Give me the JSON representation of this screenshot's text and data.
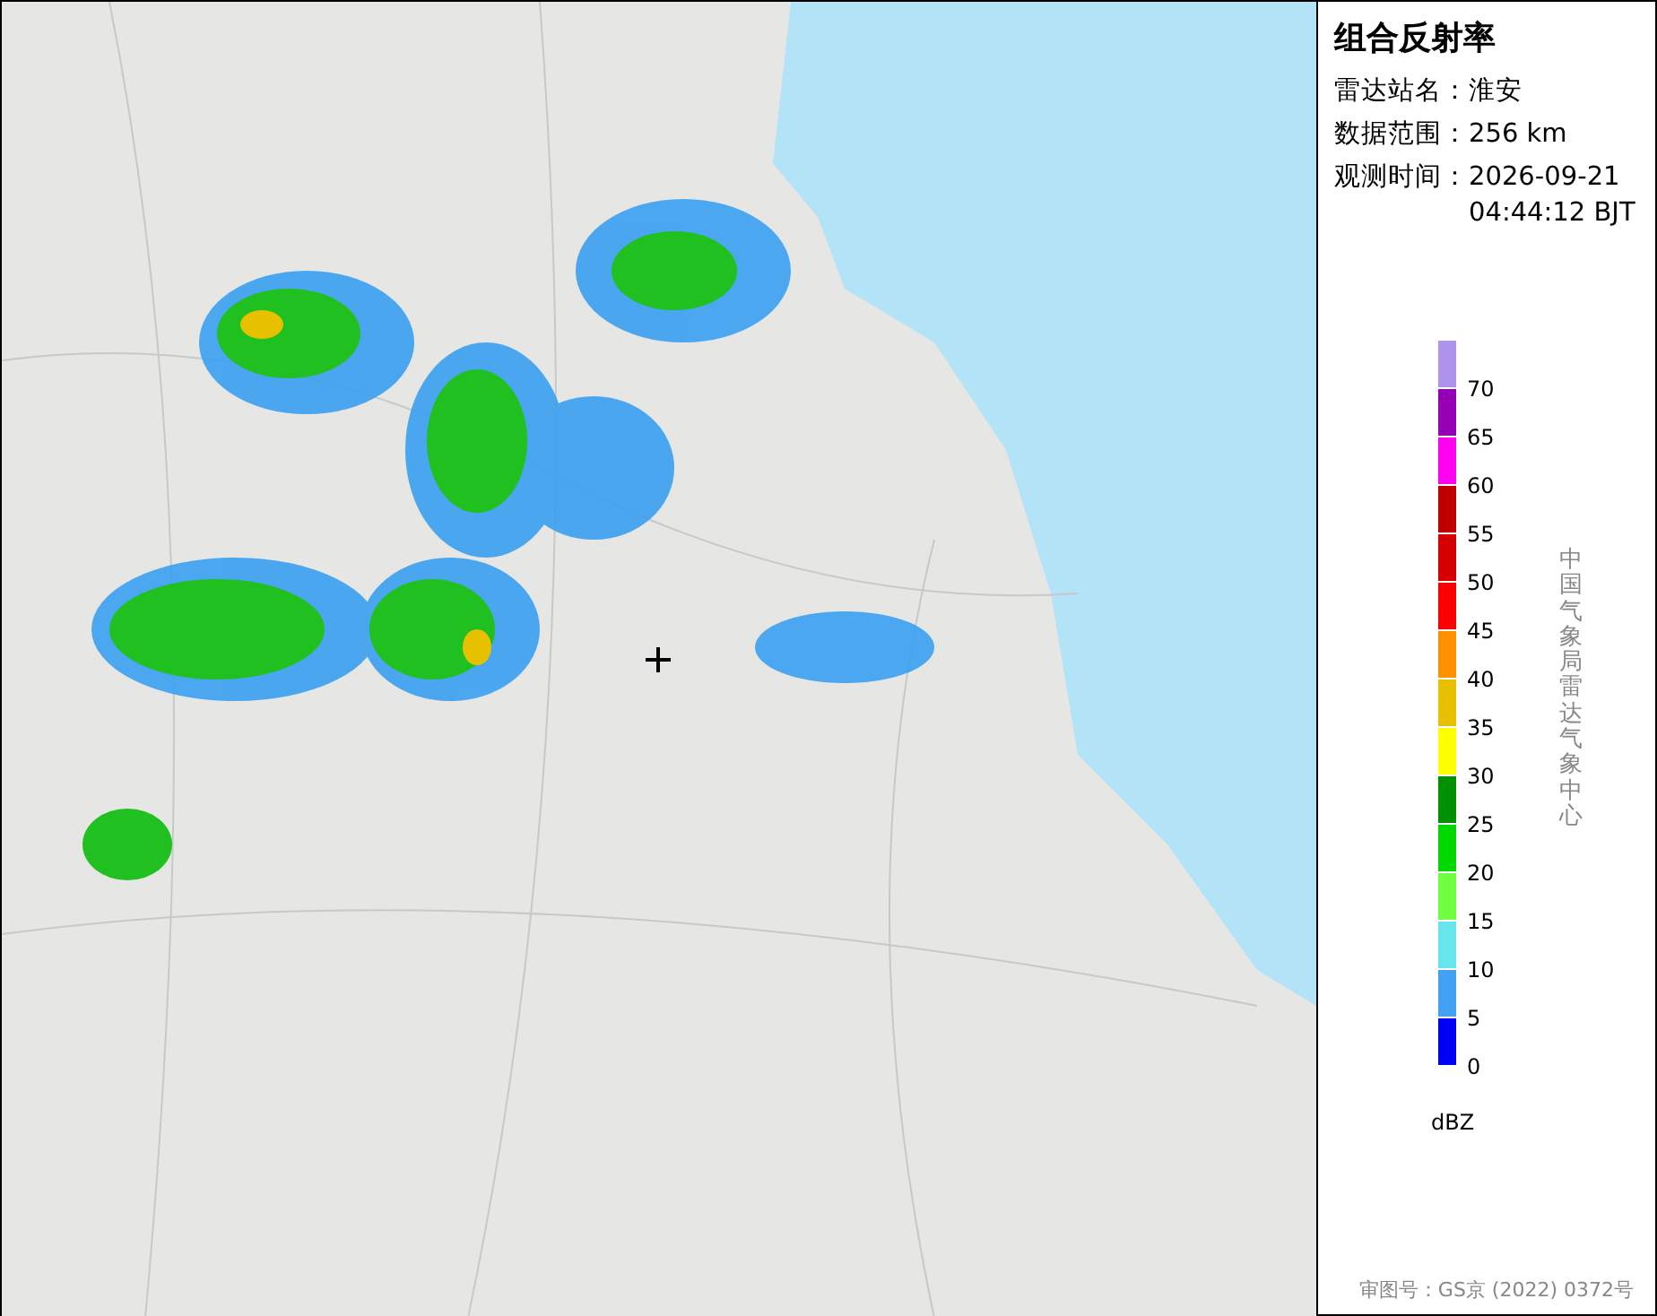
{
  "panel": {
    "title": "组合反射率",
    "info": [
      {
        "label": "雷达站名：",
        "value": "淮安"
      },
      {
        "label": "数据范围：",
        "value": "256 km"
      },
      {
        "label": "观测时间：",
        "value": "2026-09-21 04:44:12 BJT"
      }
    ]
  },
  "legend": {
    "bins": [
      {
        "color": "#ae93ed",
        "label": "70"
      },
      {
        "color": "#9600b4",
        "label": "65"
      },
      {
        "color": "#ff00f0",
        "label": "60"
      },
      {
        "color": "#c00000",
        "label": "55"
      },
      {
        "color": "#d60000",
        "label": "50"
      },
      {
        "color": "#ff0000",
        "label": "45"
      },
      {
        "color": "#ff9000",
        "label": "40"
      },
      {
        "color": "#e7c000",
        "label": "35"
      },
      {
        "color": "#ffff00",
        "label": "30"
      },
      {
        "color": "#009000",
        "label": "25"
      },
      {
        "color": "#00d800",
        "label": "20"
      },
      {
        "color": "#70ff40",
        "label": "15"
      },
      {
        "color": "#66e6ec",
        "label": "10"
      },
      {
        "color": "#42a0f5",
        "label": "5"
      },
      {
        "color": "#0000f6",
        "label": "0"
      }
    ],
    "unit": "dBZ"
  },
  "credit": "中国气象局雷达气象中心",
  "approval": "审图号：GS京 (2022) 0372号"
}
